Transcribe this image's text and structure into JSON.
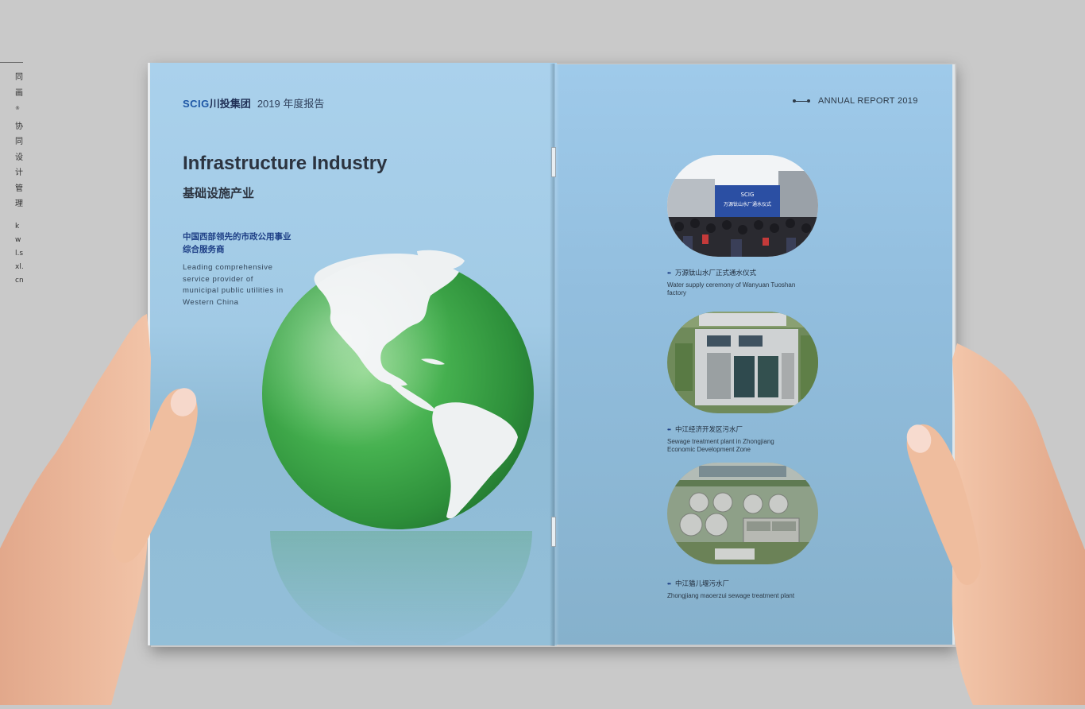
{
  "watermark": {
    "cn_chars": [
      "同",
      "画",
      "协",
      "同",
      "设",
      "计",
      "管",
      "理"
    ],
    "en_text": "kwl.sxl.cn",
    "reg_mark": "®"
  },
  "left_page": {
    "brand_logo": "SCIG",
    "brand_name": "川投集团",
    "brand_year": "2019 年度报告",
    "title": "Infrastructure Industry",
    "subtitle": "基础设施产业",
    "desc_cn": "中国西部领先的市政公用事业综合服务商",
    "desc_en": "Leading comprehensive service provider of municipal public utilities in Western China"
  },
  "right_page": {
    "header": "ANNUAL REPORT  2019",
    "photos": [
      {
        "caption_cn": "万源钛山水厂正式通水仪式",
        "caption_en": "Water supply ceremony of Wanyuan Tuoshan factory",
        "banner_logo": "SCIG",
        "banner_text": "万源钛山水厂通水仪式"
      },
      {
        "caption_cn": "中江经济开发区污水厂",
        "caption_en": "Sewage treatment plant in Zhongjiang Economic Development Zone"
      },
      {
        "caption_cn": "中江猫儿堰污水厂",
        "caption_en": "Zhongjiang maoerzui sewage treatment plant"
      }
    ]
  },
  "colors": {
    "page_blue": "#a1cae5",
    "globe_green": "#3faa4a",
    "brand_blue": "#1d56a5",
    "background": "#c9c9c9"
  }
}
